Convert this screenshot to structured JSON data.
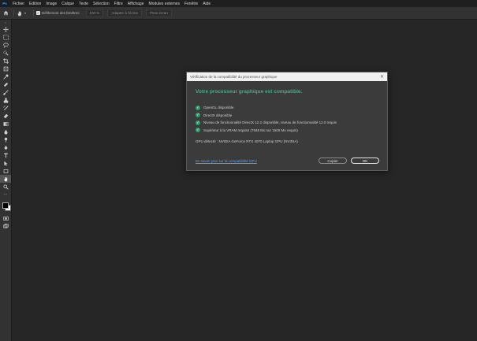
{
  "app": {
    "logo_text": "Ps"
  },
  "menu": [
    "Fichier",
    "Edition",
    "Image",
    "Calque",
    "Texte",
    "Sélection",
    "Filtre",
    "Affichage",
    "Modules externes",
    "Fenêtre",
    "Aide"
  ],
  "options": {
    "tool_icon": "hand-icon",
    "checkbox_label": "Défilement des fenêtres",
    "checkbox_checked": true,
    "zoom_button": "100 %",
    "fit_button": "Adapter à l'écran",
    "fill_button": "Plein écran"
  },
  "tools": [
    "move-icon",
    "marquee-icon",
    "lasso-icon",
    "quick-selection-icon",
    "crop-icon",
    "frame-icon",
    "eyedropper-icon",
    "healing-brush-icon",
    "brush-icon",
    "stamp-icon",
    "history-brush-icon",
    "eraser-icon",
    "gradient-icon",
    "blur-icon",
    "dodge-icon",
    "pen-icon",
    "type-icon",
    "path-selection-icon",
    "rectangle-icon",
    "hand-icon",
    "zoom-icon"
  ],
  "dialog": {
    "title": "Vérification de la compatibilité du processeur graphique",
    "heading": "Votre processeur graphique est compatible.",
    "checks": [
      "OpenGL disponible",
      "DirectX disponible",
      "Niveau de fonctionnalité DirectX 12.2 disponible, niveau de fonctionnalité 12.0 requis",
      "Supérieur à la VRAM requise (7948 Mo sur 1500 Mo requis)"
    ],
    "gpu_detected": "GPU détecté : NVIDIA GeForce RTX 4070 Laptop GPU (NVIDIA)",
    "link": "En savoir plus sur la compatibilité GPU",
    "copy_button": "Copier",
    "ok_button": "OK"
  },
  "colors": {
    "accent_green": "#31b389",
    "link_blue": "#4aa3ff",
    "foreground_swatch": "#000000",
    "background_swatch": "#ffffff"
  }
}
